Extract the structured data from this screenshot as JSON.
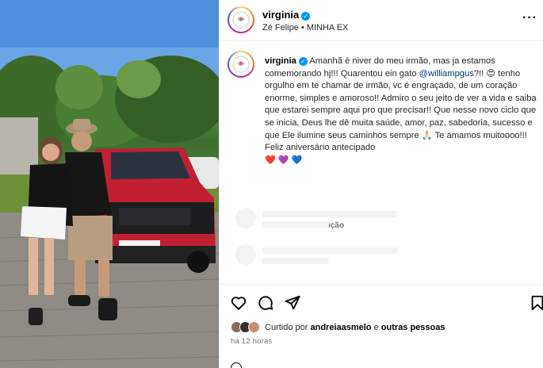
{
  "post": {
    "username": "virginia",
    "verified": true,
    "subline": "Zé Felipe • MINHA EX",
    "caption": {
      "username": "virginia",
      "before_mention": "Amanhã é niver do meu irmão, mas ja estamos comemorando hj!!! Quarentou ein gato ",
      "mention": "@williampgus",
      "after_mention": "?!! 😍 tenho orgulho em te chamar de irmão, vc é engraçado, de um coração enorme, simples e amoroso!! Admiro o seu jeito de ver a vida e saiba que estarei sempre aqui pro que precisar!! Que nesse novo ciclo que se inicia, Deus lhe dê muita saúde, amor, paz, sabedoria, sucesso e que Ele ilumine seus caminhos sempre 🙏🏻 Te amamos muitoooo!!! Feliz aniversário antecipado",
      "hearts": [
        "❤️",
        "💜",
        "💙"
      ]
    },
    "caption_age": "12 h",
    "translate_label": "Ver tradução",
    "liked_prefix": "Curtido por",
    "liked_user": "andreiaasmelo",
    "liked_suffix": "e",
    "liked_others": "outras pessoas",
    "timestamp": "há 12 horas",
    "photo_plate": "RAM"
  },
  "icons": {
    "more": "more-options-icon",
    "like": "heart-icon",
    "comment": "comment-icon",
    "share": "send-icon",
    "save": "bookmark-icon"
  },
  "colors": {
    "verified": "#0095f6",
    "link": "#00376b",
    "muted": "#737373"
  }
}
